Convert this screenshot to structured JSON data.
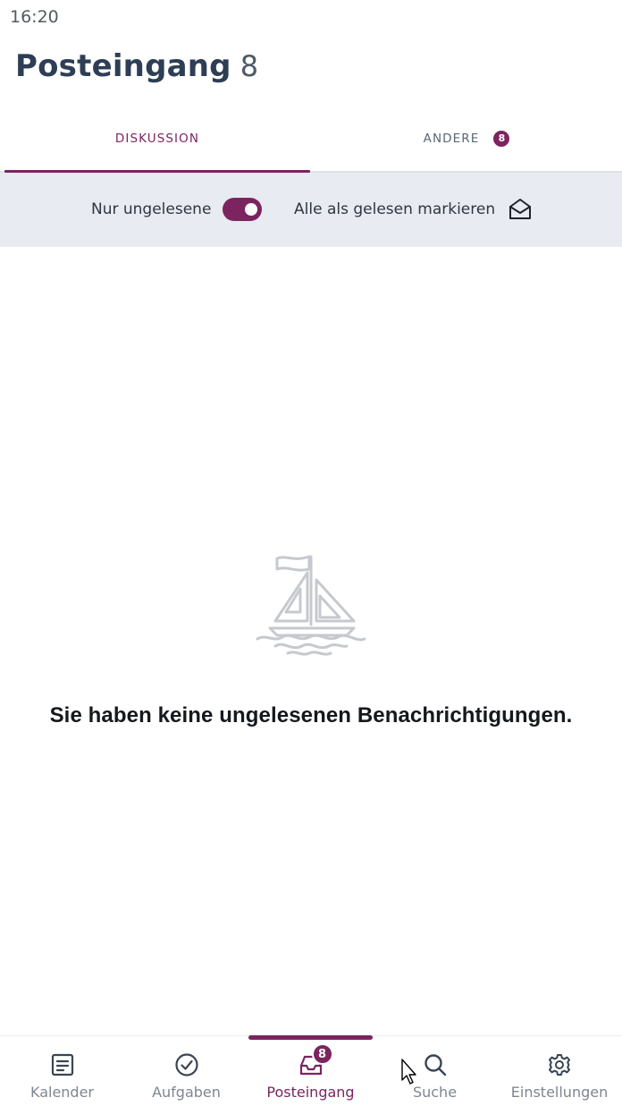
{
  "status_bar": {
    "time": "16:20"
  },
  "header": {
    "title": "Posteingang",
    "count": "8"
  },
  "tabs": [
    {
      "label": "DISKUSSION",
      "active": true
    },
    {
      "label": "ANDERE",
      "badge": "8",
      "active": false
    }
  ],
  "filter_bar": {
    "unread_only_label": "Nur ungelesene",
    "unread_only_enabled": true,
    "mark_all_read_label": "Alle als gelesen markieren"
  },
  "empty_state": {
    "icon": "sailboat-icon",
    "message": "Sie haben keine ungelesenen Benachrichtigungen."
  },
  "bottom_nav": [
    {
      "label": "Kalender",
      "icon": "calendar-icon",
      "active": false
    },
    {
      "label": "Aufgaben",
      "icon": "check-circle-icon",
      "active": false
    },
    {
      "label": "Posteingang",
      "icon": "inbox-icon",
      "active": true,
      "badge": "8"
    },
    {
      "label": "Suche",
      "icon": "search-icon",
      "active": false
    },
    {
      "label": "Einstellungen",
      "icon": "gear-icon",
      "active": false
    }
  ],
  "colors": {
    "accent": "#7b2460",
    "title": "#2d3e55",
    "filter_bg": "#e8ebf1",
    "muted": "#7f8690"
  }
}
